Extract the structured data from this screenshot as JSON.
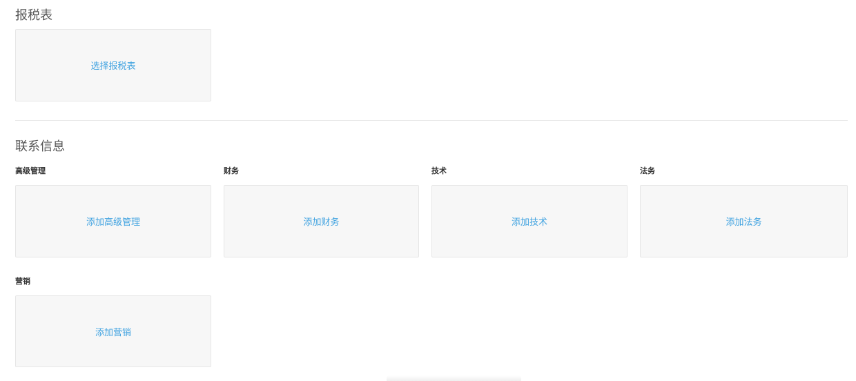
{
  "tax_section": {
    "title": "报税表",
    "select_label": "选择报税表"
  },
  "contact_section": {
    "title": "联系信息",
    "groups": [
      {
        "label": "高级管理",
        "add_label": "添加高级管理"
      },
      {
        "label": "财务",
        "add_label": "添加财务"
      },
      {
        "label": "技术",
        "add_label": "添加技术"
      },
      {
        "label": "法务",
        "add_label": "添加法务"
      },
      {
        "label": "营销",
        "add_label": "添加营销"
      }
    ]
  },
  "colors": {
    "link_blue": "#3fa2e0",
    "box_bg": "#f7f7f7",
    "box_border": "#e6e6e6",
    "divider": "#e8e8e8"
  }
}
